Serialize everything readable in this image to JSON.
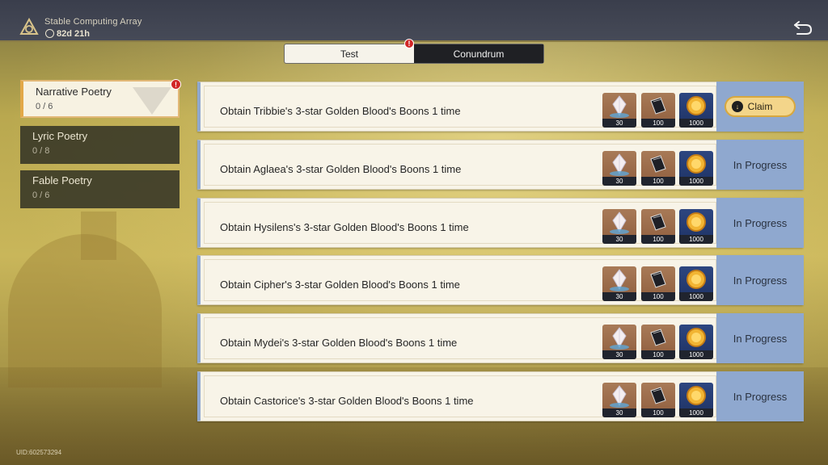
{
  "header": {
    "title": "Stable Computing Array",
    "timer": "82d 21h",
    "logo_icon": "triquetra-icon",
    "back_icon": "return-icon"
  },
  "tabs": [
    {
      "label": "Test",
      "selected": true
    },
    {
      "label": "Conundrum",
      "selected": false
    }
  ],
  "badges": {
    "alert_symbol": "!"
  },
  "sidebar": {
    "items": [
      {
        "label": "Narrative Poetry",
        "progress": "0 / 6",
        "selected": true
      },
      {
        "label": "Lyric Poetry",
        "progress": "0 / 8",
        "selected": false
      },
      {
        "label": "Fable Poetry",
        "progress": "0 / 6",
        "selected": false
      }
    ]
  },
  "quests": [
    {
      "text": "Obtain Tribbie's 3-star Golden Blood's Boons 1 time",
      "rewards": [
        {
          "icon": "crystal-icon",
          "count": "30"
        },
        {
          "icon": "book-icon",
          "count": "100"
        },
        {
          "icon": "gold-orb-icon",
          "count": "1000"
        }
      ],
      "status": "Claim"
    },
    {
      "text": "Obtain Aglaea's 3-star Golden Blood's Boons 1 time",
      "rewards": [
        {
          "icon": "crystal-icon",
          "count": "30"
        },
        {
          "icon": "book-icon",
          "count": "100"
        },
        {
          "icon": "gold-orb-icon",
          "count": "1000"
        }
      ],
      "status": "In Progress"
    },
    {
      "text": "Obtain Hysilens's 3-star Golden Blood's Boons 1 time",
      "rewards": [
        {
          "icon": "crystal-icon",
          "count": "30"
        },
        {
          "icon": "book-icon",
          "count": "100"
        },
        {
          "icon": "gold-orb-icon",
          "count": "1000"
        }
      ],
      "status": "In Progress"
    },
    {
      "text": "Obtain Cipher's 3-star Golden Blood's Boons 1 time",
      "rewards": [
        {
          "icon": "crystal-icon",
          "count": "30"
        },
        {
          "icon": "book-icon",
          "count": "100"
        },
        {
          "icon": "gold-orb-icon",
          "count": "1000"
        }
      ],
      "status": "In Progress"
    },
    {
      "text": "Obtain Mydei's 3-star Golden Blood's Boons 1 time",
      "rewards": [
        {
          "icon": "crystal-icon",
          "count": "30"
        },
        {
          "icon": "book-icon",
          "count": "100"
        },
        {
          "icon": "gold-orb-icon",
          "count": "1000"
        }
      ],
      "status": "In Progress"
    },
    {
      "text": "Obtain Castorice's 3-star Golden Blood's Boons 1 time",
      "rewards": [
        {
          "icon": "crystal-icon",
          "count": "30"
        },
        {
          "icon": "book-icon",
          "count": "100"
        },
        {
          "icon": "gold-orb-icon",
          "count": "1000"
        }
      ],
      "status": "In Progress"
    }
  ],
  "footer": {
    "uid": "UID:602573294"
  },
  "colors": {
    "accent_gold": "#e2a848",
    "status_blue": "#8fa8cf",
    "alert_red": "#d12626"
  }
}
